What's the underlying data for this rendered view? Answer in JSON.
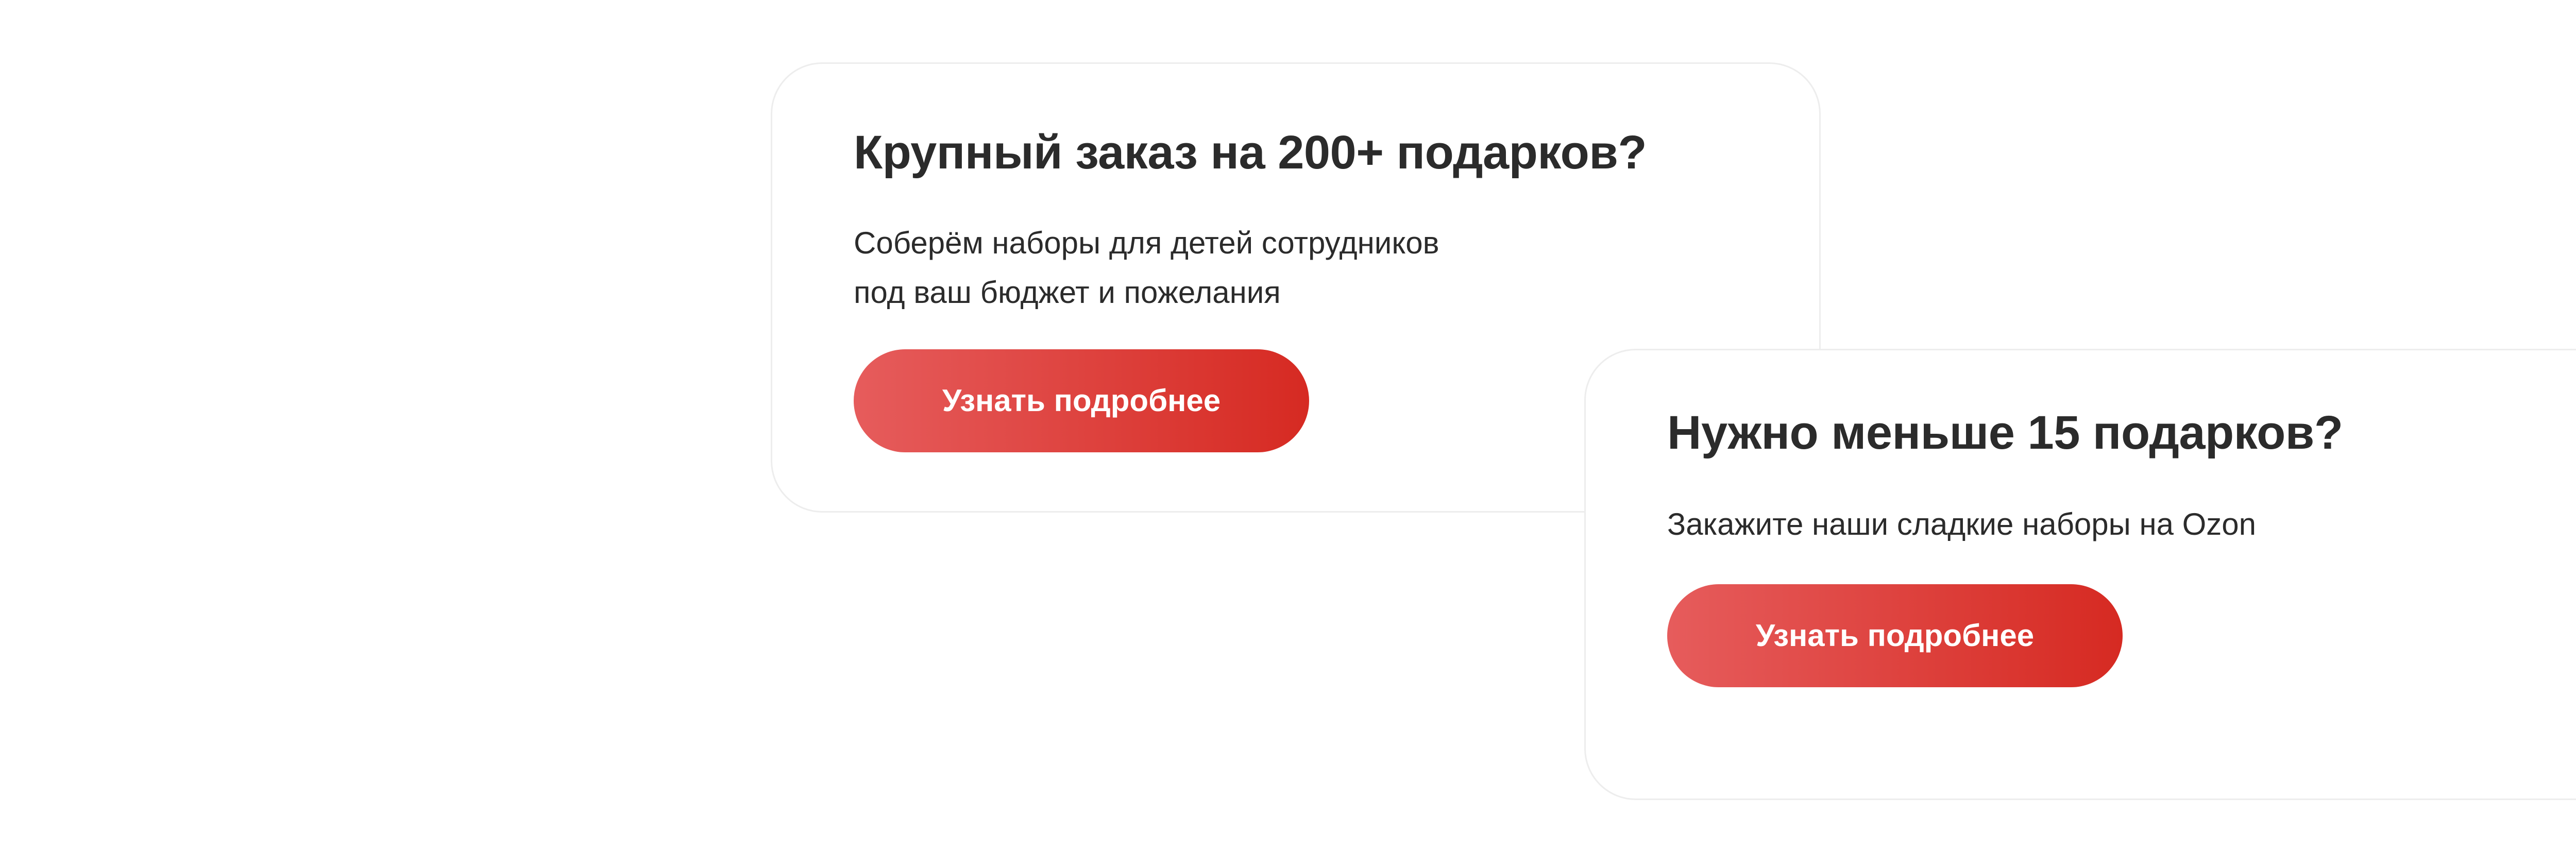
{
  "bulk_card": {
    "title": "Крупный заказ на 200+ подарков?",
    "text_line_1": "Соберём наборы для детей сотрудников",
    "text_line_2": "под ваш бюджет и пожелания",
    "button_label": "Узнать подробнее"
  },
  "small_card": {
    "title": "Нужно меньше 15 подарков?",
    "text_line_1": "Закажите наши сладкие наборы на Ozon",
    "button_label": "Узнать подробнее"
  },
  "colors": {
    "button_gradient_start": "#e65c5c",
    "button_gradient_end": "#d62a22",
    "text": "#2b2b2b",
    "card_border": "#ededed"
  }
}
